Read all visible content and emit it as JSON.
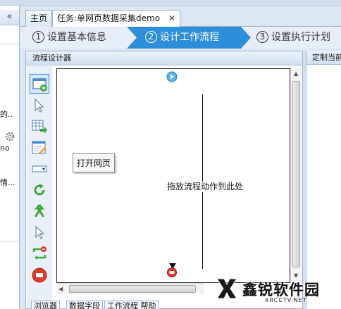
{
  "left_panel": {
    "collapse_label": "«",
    "texts": [
      "的..",
      "no",
      "情..."
    ]
  },
  "tabs": [
    {
      "label": "主页"
    },
    {
      "label": "任务:单网页数据采集demo",
      "close": "✕"
    }
  ],
  "wizard": {
    "steps": [
      {
        "num": "1",
        "label": "设置基本信息"
      },
      {
        "num": "2",
        "label": "设计工作流程"
      },
      {
        "num": "3",
        "label": "设置执行计划"
      }
    ],
    "active_step": 2
  },
  "designer": {
    "title": "流程设计器",
    "drop_hint": "拖放流程动作到此处",
    "tooltip": "打开网页",
    "tools": [
      "open-page-tool",
      "click-element-tool",
      "extract-data-tool",
      "input-text-tool",
      "select-option-tool",
      "loop-tool",
      "if-condition-tool",
      "mouse-hover-tool",
      "loop-page-tool",
      "end-loop-tool"
    ]
  },
  "right_panel": {
    "title": "定制当前"
  },
  "bottom_tabs": [
    "浏览器",
    "数据字段",
    "工作流程 帮助"
  ],
  "watermark": {
    "brand": "鑫锐软件园",
    "sub": "XRCCTV.NET"
  },
  "colors": {
    "accent": "#2f8ed9",
    "panel_border": "#9fb4cf",
    "header_bg": "#d3dfee"
  }
}
